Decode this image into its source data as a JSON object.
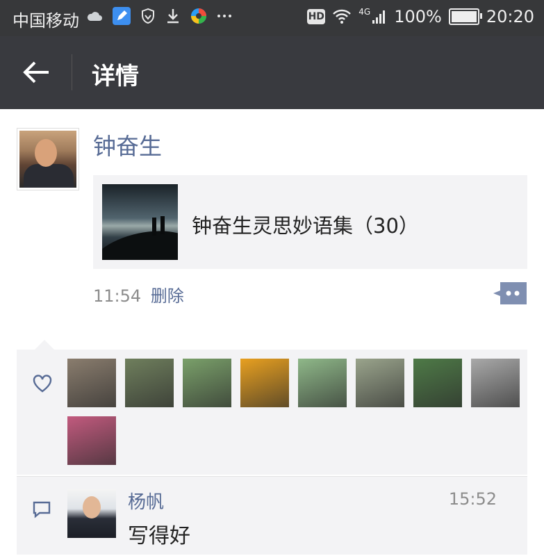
{
  "status_bar": {
    "carrier": "中国移动",
    "network": "4G",
    "battery": "100%",
    "time": "20:20",
    "hd": "HD",
    "icons": [
      "cloud-icon",
      "edit-app-icon",
      "shield-icon",
      "download-icon",
      "colorful-app-icon",
      "more-dots-icon"
    ]
  },
  "navbar": {
    "title": "详情"
  },
  "post": {
    "author": "钟奋生",
    "link_title": "钟奋生灵思妙语集（30）",
    "time": "11:54",
    "delete_label": "删除"
  },
  "likes": {
    "count": 9,
    "avatar_colors": [
      "#8a7d6e",
      "#6f7f5d",
      "#7aa06a",
      "#e8a020",
      "#8fb889",
      "#9aa48c",
      "#4e7a47",
      "#a9a9a9",
      "#c25a7e"
    ]
  },
  "comments": [
    {
      "name": "杨帆",
      "time": "15:52",
      "text": "写得好"
    }
  ],
  "colors": {
    "link_blue": "#576b95",
    "navbar": "#393a3f",
    "statusbar": "#37383a",
    "panel": "#f3f3f5"
  }
}
